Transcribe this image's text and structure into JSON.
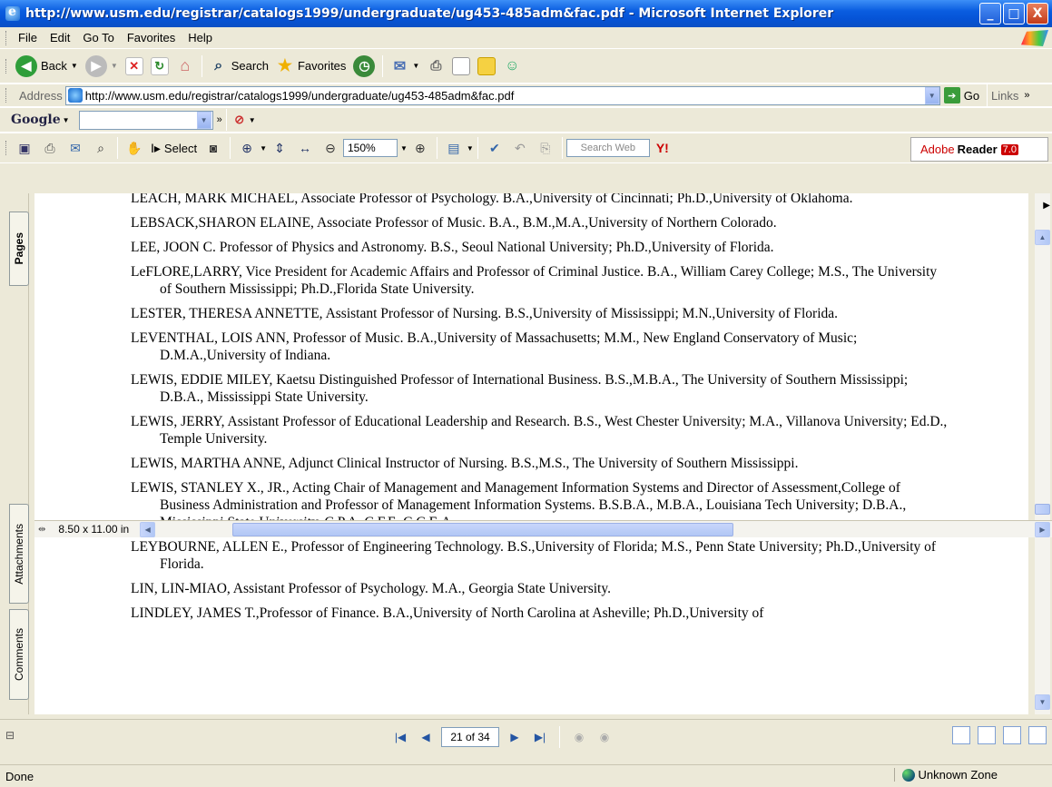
{
  "window": {
    "title": "http://www.usm.edu/registrar/catalogs1999/undergraduate/ug453-485adm&fac.pdf - Microsoft Internet Explorer",
    "btn_min": "_",
    "btn_max": "□",
    "btn_close": "X"
  },
  "menu": [
    "File",
    "Edit",
    "Go To",
    "Favorites",
    "Help"
  ],
  "toolbar": {
    "back": "Back",
    "search": "Search",
    "favorites": "Favorites"
  },
  "address": {
    "label": "Address",
    "url": "http://www.usm.edu/registrar/catalogs1999/undergraduate/ug453-485adm&fac.pdf",
    "go": "Go",
    "links": "Links"
  },
  "google": {
    "logo": "Google"
  },
  "adobe": {
    "select": "Select",
    "zoom": "150%",
    "search_web": "Search Web",
    "brand": "Adobe",
    "brand2": "Reader",
    "version": "7.0"
  },
  "sidebar": {
    "pages": "Pages",
    "attachments": "Attachments",
    "comments": "Comments"
  },
  "document": {
    "entries": [
      "LEACH, MARK MICHAEL, Associate Professor of Psychology. B.A.,University of Cincinnati; Ph.D.,University of Oklahoma.",
      "LEBSACK,SHARON ELAINE, Associate Professor of Music. B.A., B.M.,M.A.,University of Northern Colorado.",
      "LEE, JOON C. Professor of Physics and Astronomy. B.S., Seoul National University; Ph.D.,University of Florida.",
      "LeFLORE,LARRY, Vice President for Academic Affairs and Professor of Criminal Justice. B.A., William Carey College; M.S., The University of Southern Mississippi; Ph.D.,Florida State University.",
      "LESTER, THERESA ANNETTE, Assistant Professor of Nursing. B.S.,University of Mississippi; M.N.,University of Florida.",
      "LEVENTHAL, LOIS ANN, Professor of Music. B.A.,University of Massachusetts; M.M., New England Conservatory of Music; D.M.A.,University of Indiana.",
      "LEWIS, EDDIE MILEY, Kaetsu Distinguished Professor of International Business. B.S.,M.B.A., The University of Southern Mississippi; D.B.A., Mississippi State University.",
      "LEWIS, JERRY, Assistant Professor of Educational Leadership and Research. B.S., West Chester University; M.A., Villanova University; Ed.D., Temple University.",
      "LEWIS, MARTHA ANNE, Adjunct Clinical Instructor of Nursing. B.S.,M.S., The University of Southern Mississippi.",
      "LEWIS, STANLEY X., JR., Acting Chair of Management and Management Information Systems and Director of Assessment,College of Business Administration and Professor of Management Information Systems. B.S.B.A., M.B.A., Louisiana Tech University; D.B.A., Mississippi State University. C.P.A.,C.F.E.,C.C.E.A.",
      "LEYBOURNE, ALLEN E., Professor of Engineering Technology. B.S.,University of Florida; M.S., Penn State University; Ph.D.,University of Florida.",
      "LIN, LIN-MIAO, Assistant Professor of Psychology. M.A., Georgia State University.",
      "LINDLEY, JAMES T.,Professor of Finance. B.A.,University of North Carolina at Asheville; Ph.D.,University of"
    ]
  },
  "hscroll": {
    "page_size": "8.50 x 11.00 in"
  },
  "pagenav": {
    "page": "21 of 34"
  },
  "status": {
    "text": "Done",
    "zone": "Unknown Zone"
  }
}
